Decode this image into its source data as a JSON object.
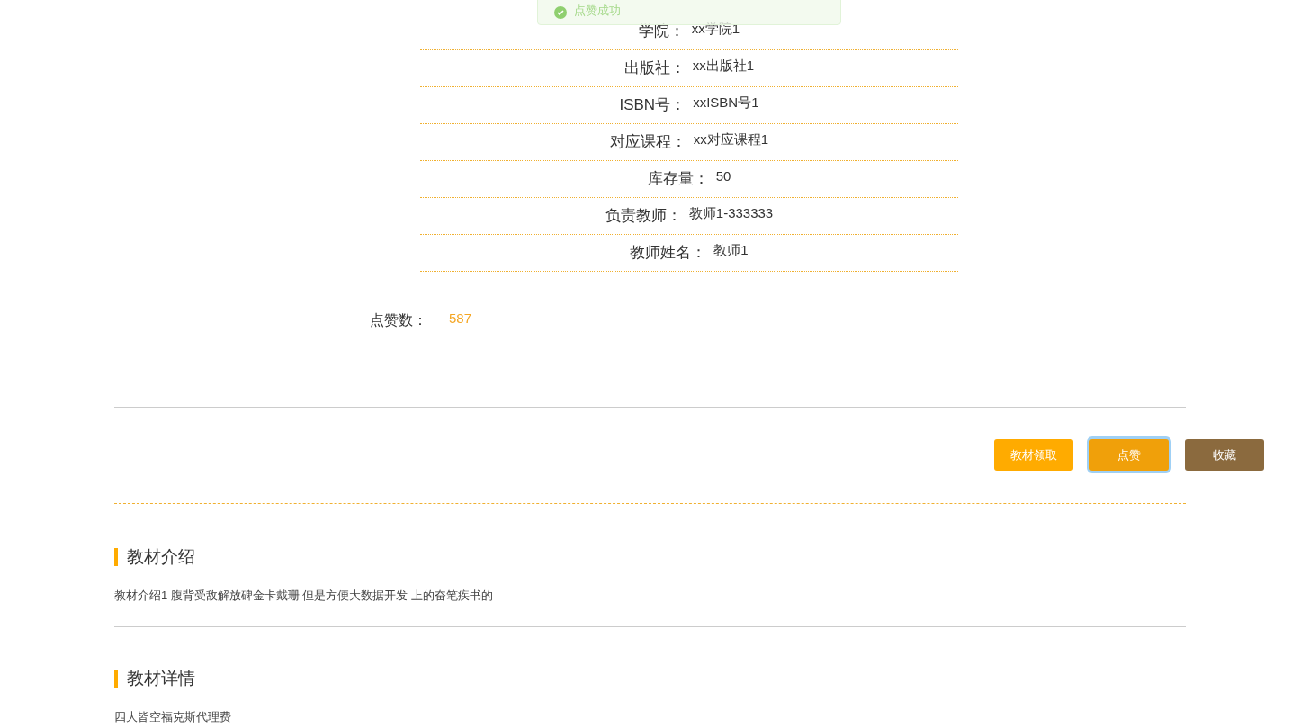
{
  "toast": {
    "message": "点赞成功"
  },
  "info_rows": [
    {
      "label": "学院：",
      "value": "xx学院1"
    },
    {
      "label": "出版社：",
      "value": "xx出版社1"
    },
    {
      "label": "ISBN号：",
      "value": "xxISBN号1"
    },
    {
      "label": "对应课程：",
      "value": "xx对应课程1"
    },
    {
      "label": "库存量：",
      "value": "50"
    },
    {
      "label": "负责教师：",
      "value": "教师1-333333"
    },
    {
      "label": "教师姓名：",
      "value": "教师1"
    }
  ],
  "likes": {
    "label": "点赞数：",
    "value": "587"
  },
  "buttons": [
    {
      "label": "教材领取",
      "color": "#ffab00",
      "selected": false
    },
    {
      "label": "点赞",
      "color": "#f0a00a",
      "selected": true
    },
    {
      "label": "收藏",
      "color": "#8b6a3e",
      "selected": false
    }
  ],
  "sections": [
    {
      "title": "教材介绍",
      "text": "教材介绍1 腹背受敌解放碑金卡戴珊 但是方便大数据开发 上的奋笔疾书的"
    },
    {
      "title": "教材详情",
      "text": "四大皆空福克斯代理费"
    }
  ]
}
